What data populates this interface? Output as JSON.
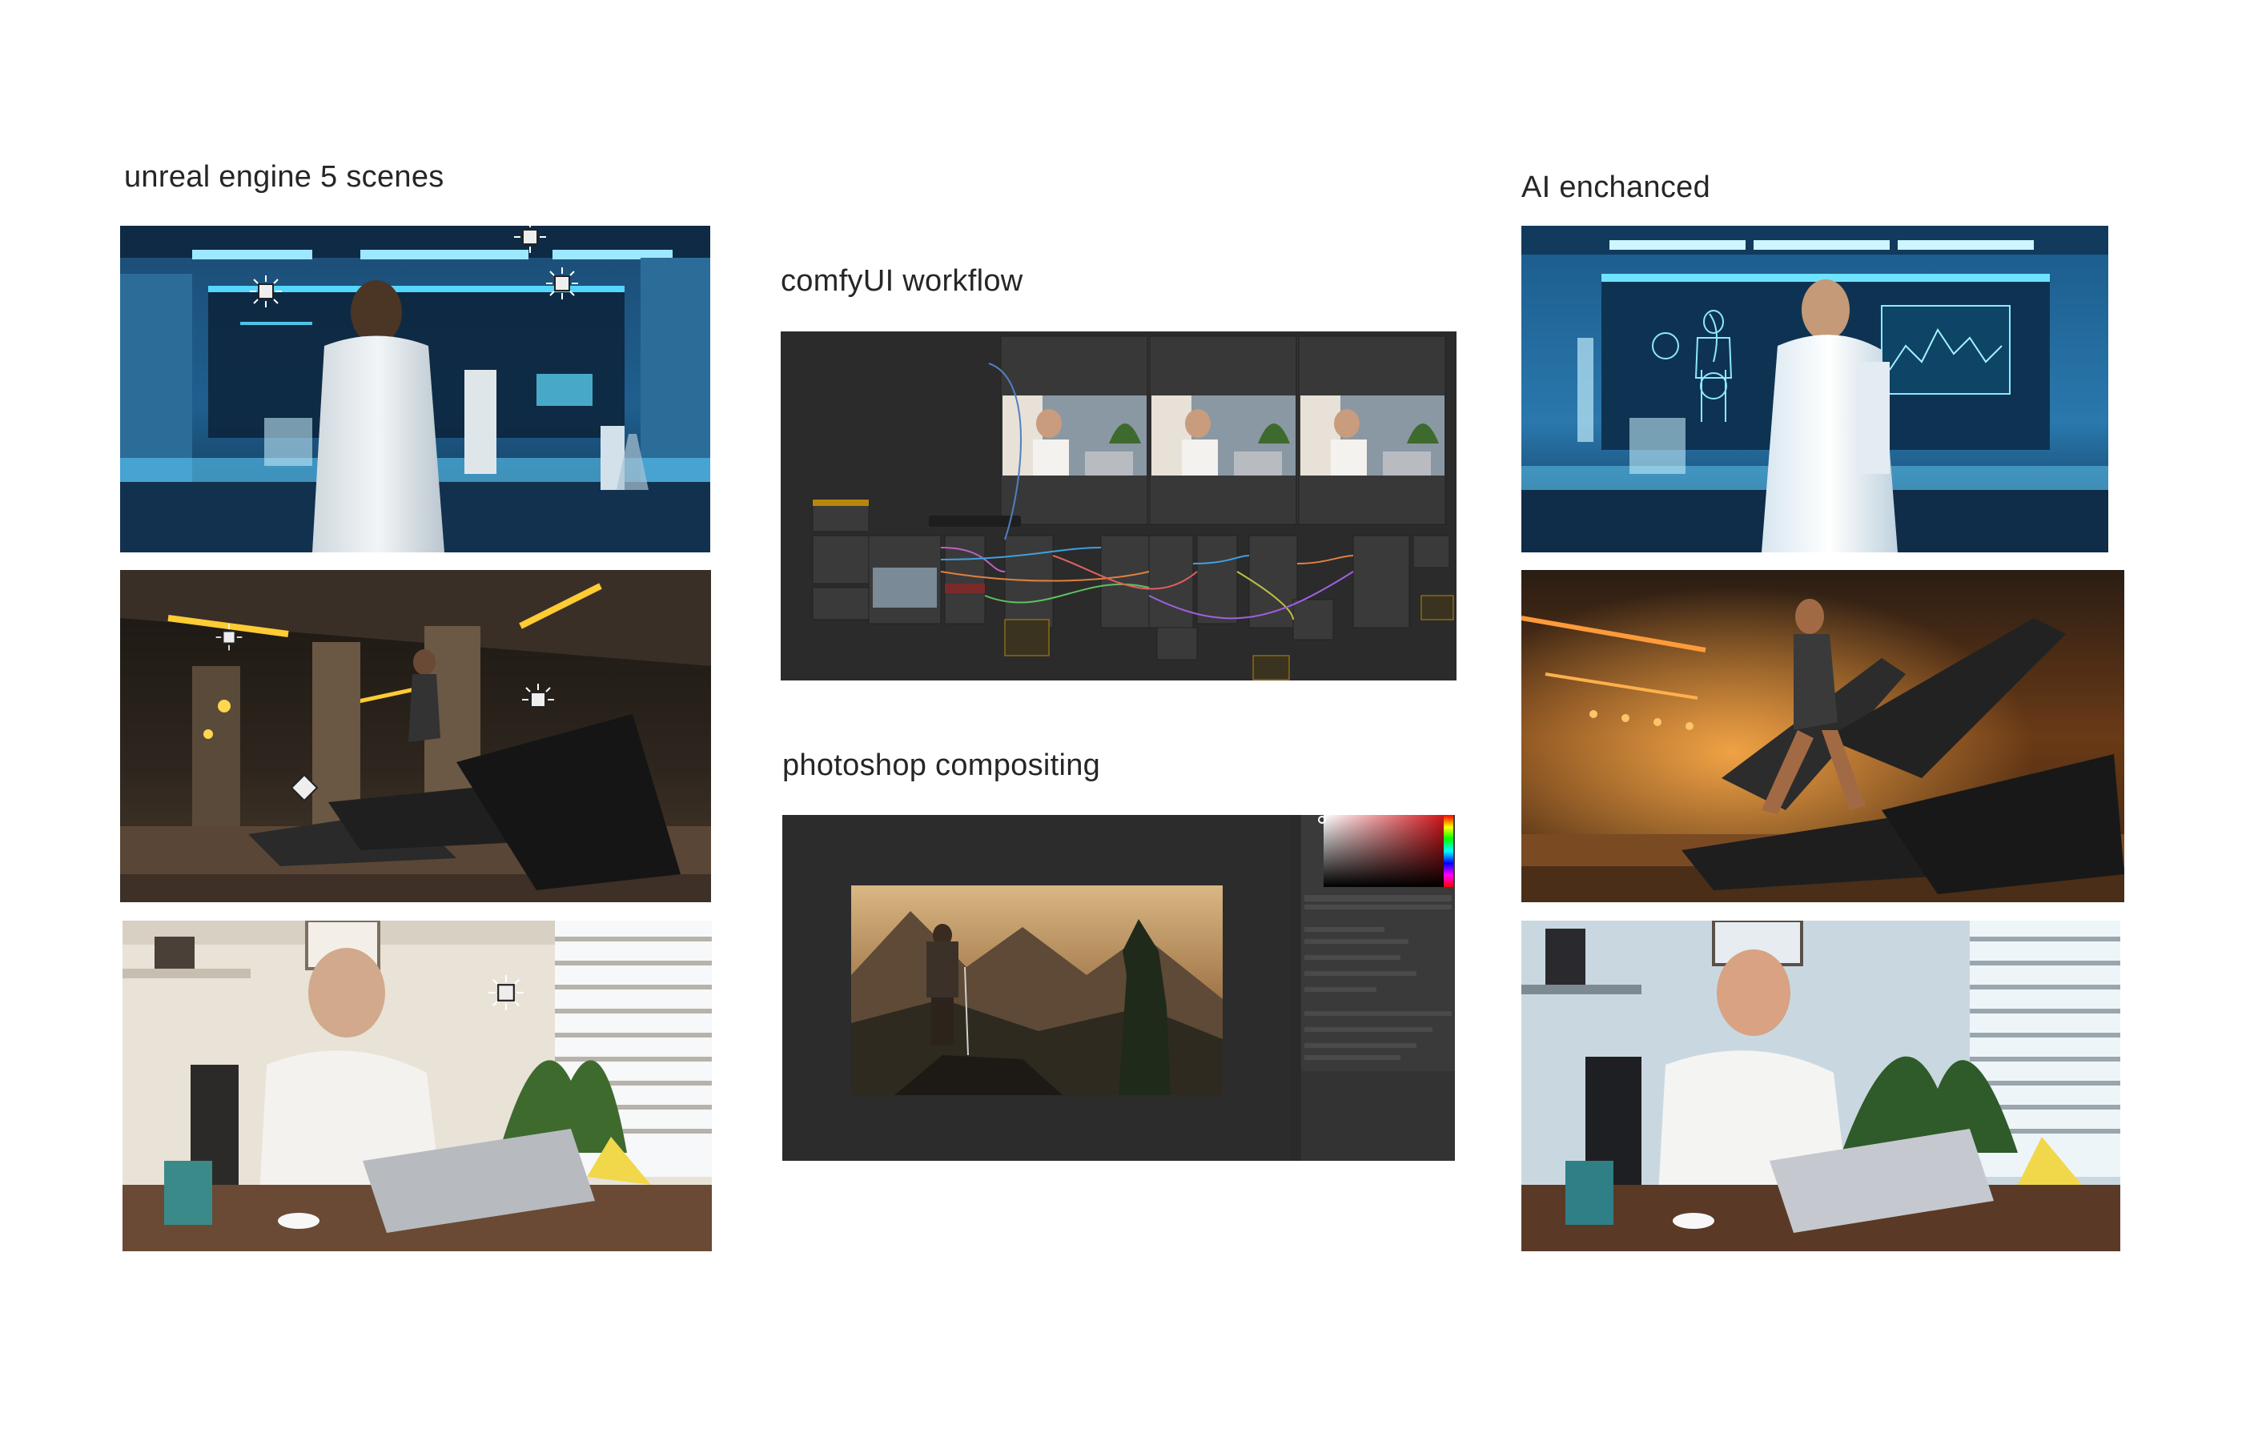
{
  "headings": {
    "unreal": "unreal engine 5 scenes",
    "comfy": "comfyUI workflow",
    "photoshop": "photoshop compositing",
    "ai": "AI enchanced"
  },
  "colors": {
    "background": "#ffffff",
    "heading_text": "#262626",
    "lab_blue": "#1f5f8f",
    "gym_dark": "#2a221b",
    "gym_orange": "#d8761d",
    "office_warm": "#e9e2d6",
    "office_cool": "#c9d8e0",
    "comfy_bg": "#2b2b2b",
    "photoshop_bg": "#2c2c2c"
  },
  "icons": [
    "light-source-icon",
    "node-icon",
    "color-picker-icon"
  ]
}
